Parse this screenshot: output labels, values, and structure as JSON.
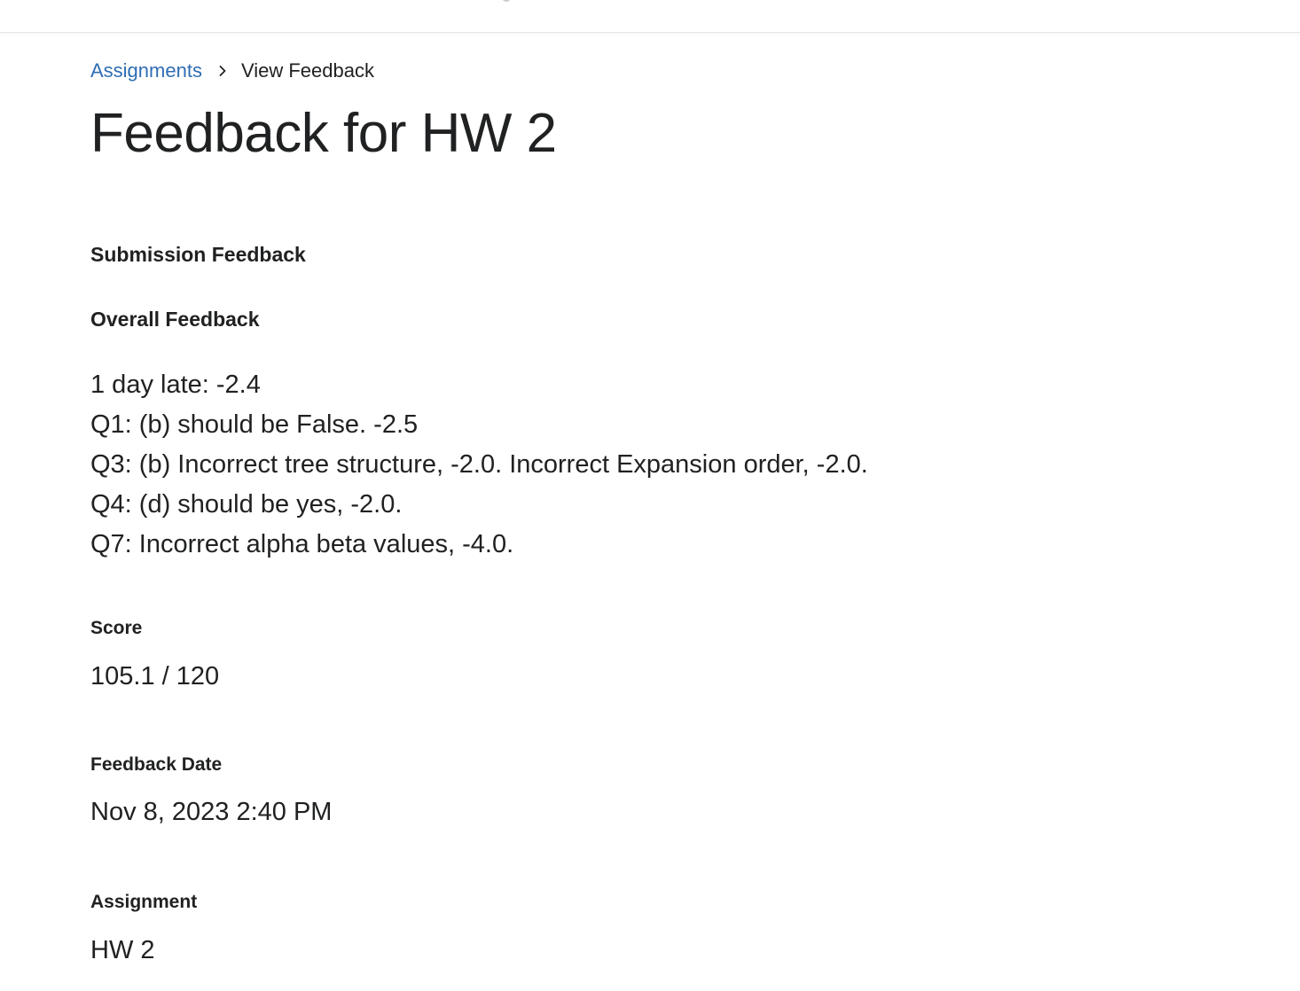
{
  "breadcrumb": {
    "parent_label": "Assignments",
    "current_label": "View Feedback"
  },
  "page": {
    "title": "Feedback for HW 2"
  },
  "submission_feedback": {
    "heading": "Submission Feedback",
    "overall_heading": "Overall Feedback",
    "lines": [
      "1 day late: -2.4",
      "Q1: (b) should be False. -2.5",
      "Q3: (b) Incorrect tree structure, -2.0. Incorrect Expansion order, -2.0.",
      "Q4: (d) should be yes, -2.0.",
      "Q7: Incorrect alpha beta values, -4.0."
    ]
  },
  "score": {
    "label": "Score",
    "value": "105.1 / 120"
  },
  "feedback_date": {
    "label": "Feedback Date",
    "value": "Nov 8, 2023 2:40 PM"
  },
  "assignment": {
    "label": "Assignment",
    "value": "HW 2"
  },
  "colors": {
    "link": "#2e6db4",
    "text": "#202122",
    "border": "#e3e6e8"
  }
}
